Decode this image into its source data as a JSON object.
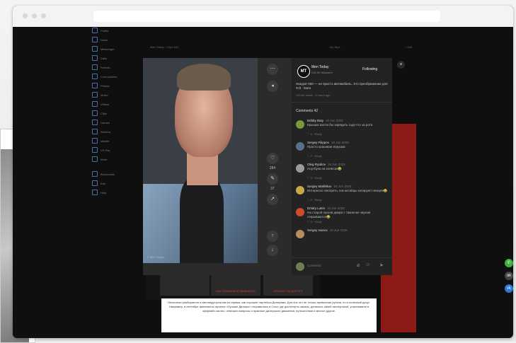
{
  "sidebar": {
    "items": [
      {
        "label": "Profile"
      },
      {
        "label": "News"
      },
      {
        "label": "Messenger"
      },
      {
        "label": "Calls"
      },
      {
        "label": "Friends"
      },
      {
        "label": "Communities"
      },
      {
        "label": "Photos"
      },
      {
        "label": "Music"
      },
      {
        "label": "Videos"
      },
      {
        "label": "Clips"
      },
      {
        "label": "Games"
      },
      {
        "label": "Stickers"
      },
      {
        "label": "Market"
      },
      {
        "label": "VK Pay"
      },
      {
        "label": "Work"
      },
      {
        "label": "Bookmarks"
      },
      {
        "label": "Ads"
      },
      {
        "label": "Help"
      }
    ]
  },
  "page": {
    "breadcrumb": "Men Today · Clips 443",
    "top_right": "My clips",
    "top_right_2": "+ Add"
  },
  "video": {
    "caption": "© Men Today"
  },
  "controls": {
    "more": "⋯",
    "like_count": "284",
    "comment_count": "37"
  },
  "channel": {
    "avatar_text": "MT",
    "name": "Men Today",
    "subscribers": "336.5K followers",
    "follow_label": "Following",
    "description": "Ниндзя H50 — не просто автомобиль. Это преображение для #clt · More",
    "meta": "125.6K views · 3 hours ago"
  },
  "comments": {
    "title": "Comments 42",
    "list": [
      {
        "author": "Bobby Baty",
        "date": "19 Jun 2025",
        "text": "Крышка могла бы зарядить года что за рота",
        "meta": "♡ 6 · Reply",
        "color": "#7a9a3b"
      },
      {
        "author": "Sergey Filippov",
        "date": "18 Jun 2025",
        "text": "Просто красивая игрушка",
        "meta": "♡ 2 · Reply",
        "color": "#5b6f8c"
      },
      {
        "author": "Oleg Ryabov",
        "date": "18 Jun 2025",
        "text": "Ноутбука на колёсах😂",
        "meta": "♡ 3 · Reply",
        "color": "#9a9a9a"
      },
      {
        "author": "Sergey Makhikov",
        "date": "18 Jun 2025",
        "text": "Интересно смотреть, как китайцы копируют немцев😂",
        "meta": "♡ 2 · Reply",
        "color": "#c8a94a"
      },
      {
        "author": "Dmitry Lukin",
        "date": "18 Jun 2025",
        "text": "На старой пусков двери с таким же звуком открываются😂",
        "meta": "♡ 4 · Reply",
        "color": "#d24b2b"
      },
      {
        "author": "Sergey Ivanov",
        "date": "18 Jun 2025",
        "text": "",
        "meta": "",
        "color": "#b98d5b"
      }
    ],
    "input_placeholder": "Comment"
  },
  "thumbnails": [
    {
      "caption": "КАК ПРАВИЛЬНО ВЫБИРАТЬ"
    },
    {
      "caption": "ОПАСНО НА ДОРОГЕ"
    }
  ],
  "article": {
    "text": "Несколько разбирается в автоиндустрии как из гаража, как хорошие партнёры Дилерами. Для них это не только привычная рутина, но и полезный досуг. Например, в сентябре финалисты проекта «Лучшие Дилеры» отправились в Сочи, где достигнуты заказы, делились своей экспертизой, участвовали в оффлайн-частях, отвечали вопросы о практике дилерского движения, путешествия и многое другое."
  }
}
